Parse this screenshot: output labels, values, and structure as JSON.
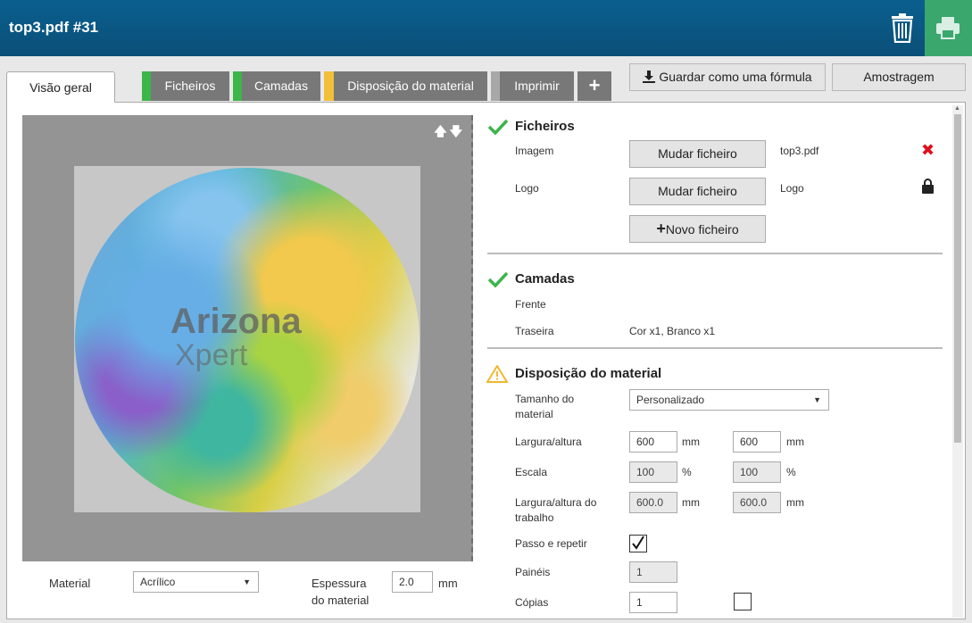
{
  "header": {
    "title": "top3.pdf #31",
    "colors": {
      "bar": "#0b5a87",
      "print": "#3aa76d"
    }
  },
  "tabs": [
    {
      "label": "Visão geral",
      "active": true
    },
    {
      "label": "Ficheiros",
      "color": "#3cb54a"
    },
    {
      "label": "Camadas",
      "color": "#3cb54a"
    },
    {
      "label": "Disposição do material",
      "color": "#f2c038"
    },
    {
      "label": "Imprimir",
      "color": "#a8a8a8"
    },
    {
      "label": "+"
    }
  ],
  "actions": {
    "save_formula": "Guardar como uma fórmula",
    "sampling": "Amostragem"
  },
  "preview": {
    "brand_line1": "Arizona",
    "brand_line2": "Xpert"
  },
  "left_form": {
    "material_label": "Material",
    "material_value": "Acrílico",
    "thickness_label_1": "Espessura",
    "thickness_label_2": "do material",
    "thickness_value": "2.0",
    "thickness_unit": "mm"
  },
  "files": {
    "title": "Ficheiros",
    "image_label": "Imagem",
    "change_file": "Mudar ficheiro",
    "image_file": "top3.pdf",
    "logo_label": "Logo",
    "logo_file": "Logo",
    "new_file": "Novo ficheiro"
  },
  "layers": {
    "title": "Camadas",
    "front_label": "Frente",
    "back_label": "Traseira",
    "back_value": "Cor x1, Branco x1"
  },
  "layout": {
    "title": "Disposição do material",
    "size_label_1": "Tamanho do",
    "size_label_2": "material",
    "size_value": "Personalizado",
    "wh_label": "Largura/altura",
    "width": "600",
    "height": "600",
    "unit_mm": "mm",
    "scale_label": "Escala",
    "scale_x": "100",
    "scale_y": "100",
    "unit_pct": "%",
    "job_wh_label_1": "Largura/altura do",
    "job_wh_label_2": "trabalho",
    "job_w": "600.0",
    "job_h": "600.0",
    "step_repeat_label": "Passo e repetir",
    "step_repeat_checked": true,
    "panels_label": "Painéis",
    "panels_value": "1",
    "copies_label": "Cópias",
    "copies_value": "1"
  }
}
